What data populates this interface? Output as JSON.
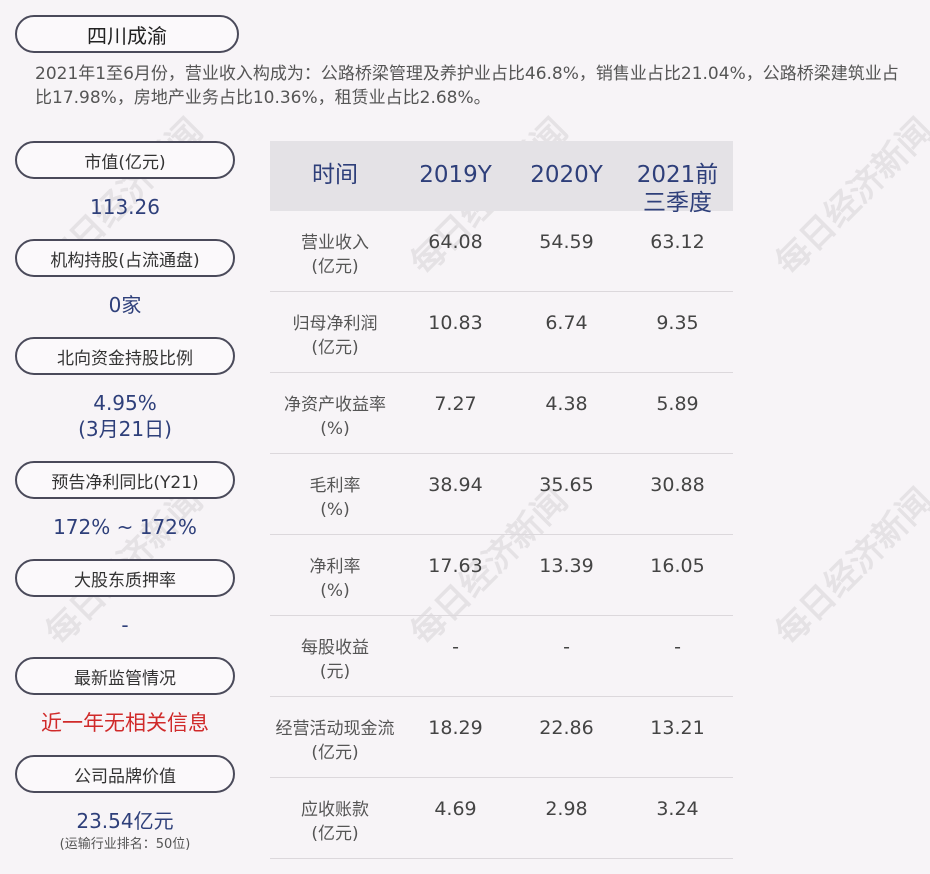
{
  "company": "四川成渝",
  "summary": "2021年1至6月份，营业收入构成为：公路桥梁管理及养护业占比46.8%，销售业占比21.04%，公路桥梁建筑业占比17.98%，房地产业务占比10.36%，租赁业占比2.68%。",
  "watermark": "每日经济新闻",
  "sidebar": [
    {
      "label": "市值(亿元)",
      "value": "113.26"
    },
    {
      "label": "机构持股(占流通盘)",
      "value": "0家"
    },
    {
      "label": "北向资金持股比例",
      "value": "4.95%",
      "value2": "(3月21日)"
    },
    {
      "label": "预告净利同比(Y21)",
      "value": "172% ~ 172%"
    },
    {
      "label": "大股东质押率",
      "value": "-"
    },
    {
      "label": "最新监管情况",
      "value": "近一年无相关信息"
    },
    {
      "label": "公司品牌价值",
      "value": "23.54亿元",
      "sub": "(运输行业排名：50位)"
    }
  ],
  "table": {
    "headers": [
      "时间",
      "2019Y",
      "2020Y",
      "2021前三季度"
    ],
    "rows": [
      {
        "label": "营业收入",
        "unit": "(亿元)",
        "values": [
          "64.08",
          "54.59",
          "63.12"
        ]
      },
      {
        "label": "归母净利润",
        "unit": "(亿元)",
        "values": [
          "10.83",
          "6.74",
          "9.35"
        ]
      },
      {
        "label": "净资产收益率",
        "unit": "(%)",
        "values": [
          "7.27",
          "4.38",
          "5.89"
        ]
      },
      {
        "label": "毛利率",
        "unit": "(%)",
        "values": [
          "38.94",
          "35.65",
          "30.88"
        ]
      },
      {
        "label": "净利率",
        "unit": "(%)",
        "values": [
          "17.63",
          "13.39",
          "16.05"
        ]
      },
      {
        "label": "每股收益",
        "unit": "(元)",
        "values": [
          "-",
          "-",
          "-"
        ]
      },
      {
        "label": "经营活动现金流",
        "unit": "(亿元)",
        "values": [
          "18.29",
          "22.86",
          "13.21"
        ]
      },
      {
        "label": "应收账款",
        "unit": "(亿元)",
        "values": [
          "4.69",
          "2.98",
          "3.24"
        ]
      }
    ]
  }
}
